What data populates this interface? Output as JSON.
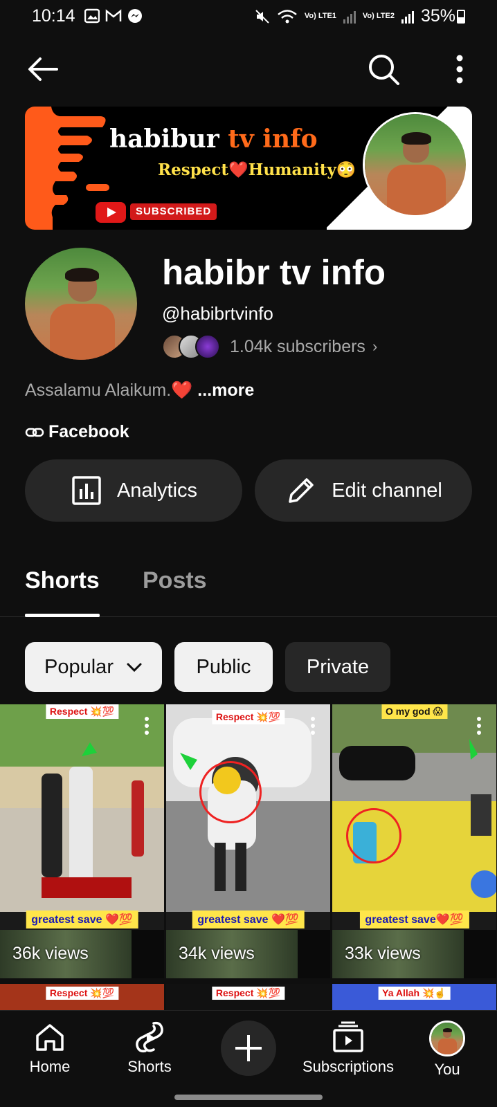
{
  "status_bar": {
    "time": "10:14",
    "signal1": "Vo) LTE1",
    "signal2": "Vo) LTE2",
    "battery": "35%"
  },
  "banner": {
    "title_part1": "habibur",
    "title_part2": "tv info",
    "subtitle": "Respect❤️Humanity😳",
    "subscribed_badge": "SUBSCRIBED"
  },
  "channel": {
    "name": "habibr tv info",
    "handle": "@habibrtvinfo",
    "subscribers": "1.04k subscribers",
    "description": "Assalamu Alaikum.",
    "description_emoji": "❤️",
    "more_label": "...more",
    "link_label": "Facebook"
  },
  "actions": {
    "analytics_label": "Analytics",
    "edit_label": "Edit channel"
  },
  "tabs": [
    {
      "label": "Shorts",
      "selected": true
    },
    {
      "label": "Posts",
      "selected": false
    }
  ],
  "filters": [
    {
      "label": "Popular",
      "selected": true
    },
    {
      "label": "Public",
      "selected": true
    },
    {
      "label": "Private",
      "selected": false
    }
  ],
  "shorts": [
    {
      "top_caption": "Respect 💥💯",
      "bottom_label": "greatest save ❤️💯",
      "views": "36k views"
    },
    {
      "top_caption": "Respect 💥💯",
      "bottom_label": "greatest save ❤️💯",
      "views": "34k views"
    },
    {
      "top_caption": "O my god 😱",
      "bottom_label": "greatest save❤️💯",
      "views": "33k views"
    }
  ],
  "shorts_row2": [
    {
      "top_caption": "Respect 💥💯"
    },
    {
      "top_caption": "Respect 💥💯"
    },
    {
      "top_caption": "Ya Allah 💥☝️"
    }
  ],
  "bottom_nav": {
    "home": "Home",
    "shorts": "Shorts",
    "subscriptions": "Subscriptions",
    "you": "You"
  },
  "colors": {
    "background": "#0f0f0f",
    "chip_selected": "#f1f1f1",
    "chip_unselected": "#272727",
    "secondary_text": "#aaaaaa",
    "brand_orange": "#ff6a1a"
  },
  "icons": [
    "back-arrow-icon",
    "search-icon",
    "more-vert-icon",
    "analytics-icon",
    "pencil-icon",
    "link-icon",
    "chevron-down-icon",
    "home-icon",
    "shorts-icon",
    "create-icon",
    "subscriptions-icon"
  ]
}
